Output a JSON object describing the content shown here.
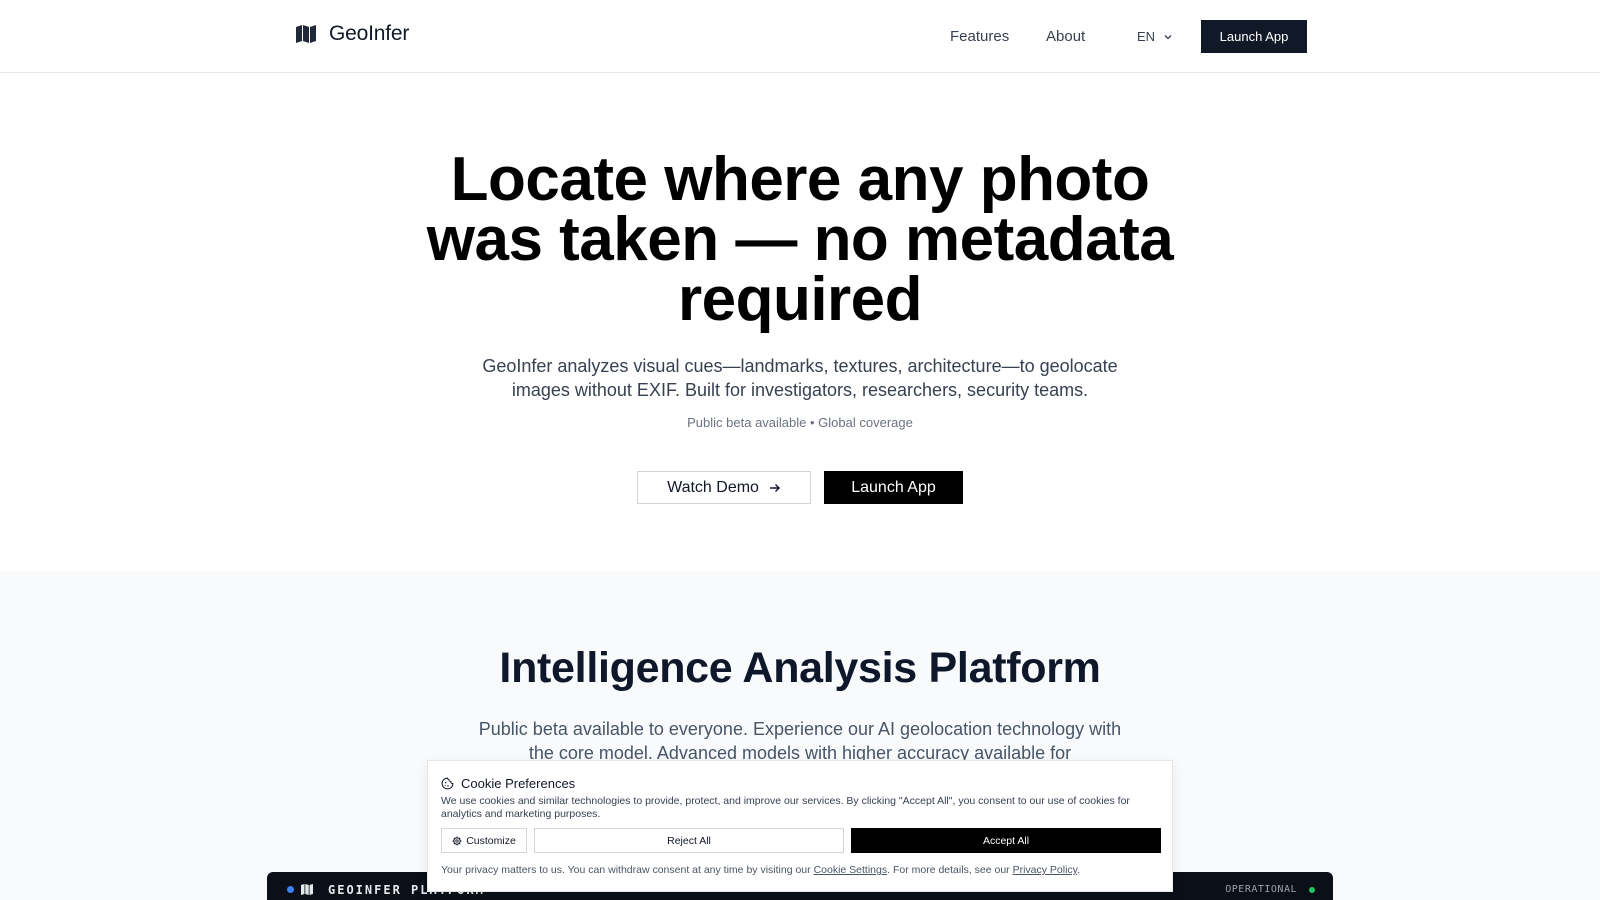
{
  "header": {
    "brand": "GeoInfer",
    "nav": {
      "features": "Features",
      "about": "About"
    },
    "language": "EN",
    "launch_label": "Launch App"
  },
  "hero": {
    "title_lines": [
      "Locate where any photo",
      "was taken — no metadata",
      "required"
    ],
    "subtitle_lines": [
      "GeoInfer analyzes visual cues—landmarks, textures, architecture—to geolocate",
      "images without EXIF. Built for investigators, researchers, security teams."
    ],
    "note": "Public beta available • Global coverage",
    "demo_label": "Watch Demo",
    "launch_label": "Launch App"
  },
  "platform_section": {
    "title": "Intelligence Analysis Platform",
    "text_lines": [
      "Public beta available to everyone. Experience our AI geolocation technology with",
      "the core model. Advanced models with higher accuracy available for"
    ],
    "bar_name": "GEOINFER PLATFORM",
    "bar_status": "OPERATIONAL"
  },
  "cookie": {
    "title": "Cookie Preferences",
    "body": "We use cookies and similar technologies to provide, protect, and improve our services. By clicking \"Accept All\", you consent to our use of cookies for analytics and marketing purposes.",
    "customize_label": "Customize",
    "reject_label": "Reject All",
    "accept_label": "Accept All",
    "footer_prefix": "Your privacy matters to us. You can withdraw consent at any time by visiting our ",
    "settings_link": "Cookie Settings",
    "footer_middle": ". For more details, see our ",
    "privacy_link": "Privacy Policy",
    "footer_suffix": "."
  },
  "colors": {
    "primary_dark": "#111827",
    "black": "#000000",
    "section_bg": "#f8fafc",
    "status_green": "#22c55e",
    "accent_blue": "#3b82f6"
  },
  "icons": [
    "map-icon",
    "chevron-down-icon",
    "arrow-right-icon",
    "cookie-icon",
    "gear-icon"
  ]
}
